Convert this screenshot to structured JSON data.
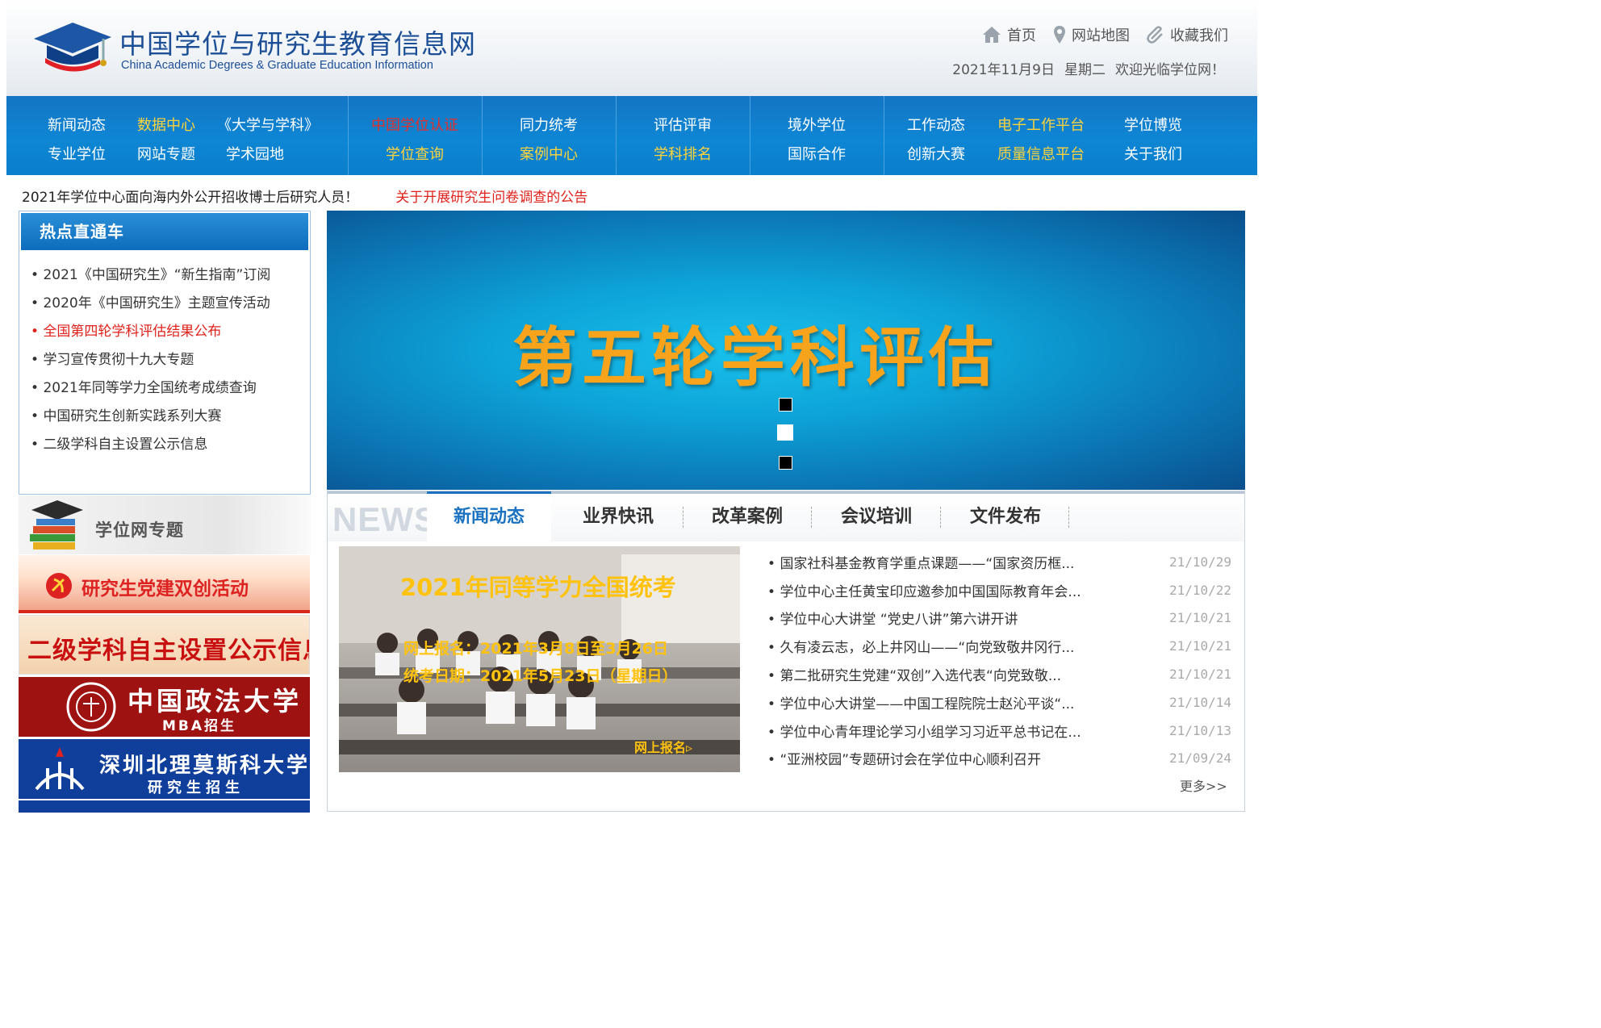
{
  "header": {
    "title": "中国学位与研究生教育信息网",
    "subtitle": "China Academic Degrees & Graduate Education Information",
    "top_links": [
      {
        "label": "首页",
        "icon": "home-icon"
      },
      {
        "label": "网站地图",
        "icon": "location-pin-icon"
      },
      {
        "label": "收藏我们",
        "icon": "paperclip-icon"
      }
    ],
    "date": "2021年11月9日",
    "weekday": "星期二",
    "welcome": "欢迎光临学位网！"
  },
  "nav": {
    "g1": [
      "新闻动态",
      "数据中心",
      "《大学与学科》",
      "专业学位",
      "网站专题",
      "学术园地"
    ],
    "g2": [
      "中国学位认证",
      "学位查询"
    ],
    "g3": [
      "同力统考",
      "案例中心"
    ],
    "g4": [
      "评估评审",
      "学科排名"
    ],
    "g5": [
      "境外学位",
      "国际合作"
    ],
    "g6": [
      "工作动态",
      "电子工作平台",
      "学位博览",
      "创新大赛",
      "质量信息平台",
      "关于我们"
    ]
  },
  "ticker": {
    "item1": "2021年学位中心面向海内外公开招收博士后研究人员！",
    "item2": "关于开展研究生问卷调查的公告"
  },
  "hot": {
    "title": "热点直通车",
    "items": [
      "2021《中国研究生》“新生指南”订阅",
      "2020年《中国研究生》主题宣传活动",
      "全国第四轮学科评估结果公布",
      "学习宣传贯彻十九大专题",
      "2021年同等学力全国统考成绩查询",
      "中国研究生创新实践系列大赛",
      "二级学科自主设置公示信息"
    ]
  },
  "topics": {
    "title": "学位网专题",
    "banners": [
      {
        "text": "研究生党建双创活动"
      },
      {
        "text": "二级学科自主设置公示信息"
      },
      {
        "text": "中国政法大学",
        "sub": "MBA招生"
      },
      {
        "text": "深圳北理莫斯科大学",
        "sub": "研究生招生"
      }
    ]
  },
  "slide": {
    "title": "第五轮学科评估"
  },
  "news": {
    "logo": "NEWS",
    "tabs": [
      "新闻动态",
      "业界快讯",
      "改革案例",
      "会议培训",
      "文件发布"
    ],
    "photo": {
      "title": "2021年同等学力全国统考",
      "line1": "网上报名：2021年3月8日至3月26日",
      "line2": "统考日期：2021年5月23日（星期日）",
      "cta": "网上报名▹"
    },
    "items": [
      {
        "title": "国家社科基金教育学重点课题——“国家资历框...",
        "date": "21/10/29"
      },
      {
        "title": "学位中心主任黄宝印应邀参加中国国际教育年会...",
        "date": "21/10/22"
      },
      {
        "title": "学位中心大讲堂 “党史八讲”第六讲开讲",
        "date": "21/10/21"
      },
      {
        "title": "久有凌云志，必上井冈山——“向党致敬井冈行...",
        "date": "21/10/21"
      },
      {
        "title": "第二批研究生党建“双创”入选代表“向党致敬...",
        "date": "21/10/21"
      },
      {
        "title": "学位中心大讲堂——中国工程院院士赵沁平谈“...",
        "date": "21/10/14"
      },
      {
        "title": "学位中心青年理论学习小组学习习近平总书记在...",
        "date": "21/10/13"
      },
      {
        "title": "“亚洲校园”专题研讨会在学位中心顺利召开",
        "date": "21/09/24"
      }
    ],
    "more": "更多>>"
  },
  "colors": {
    "nav_blue": "#0e86d4",
    "nav_highlight": "#ffd33a",
    "alert_red": "#e0221c",
    "title_blue": "#1d4f97",
    "slide_title": "#f7a31c"
  }
}
